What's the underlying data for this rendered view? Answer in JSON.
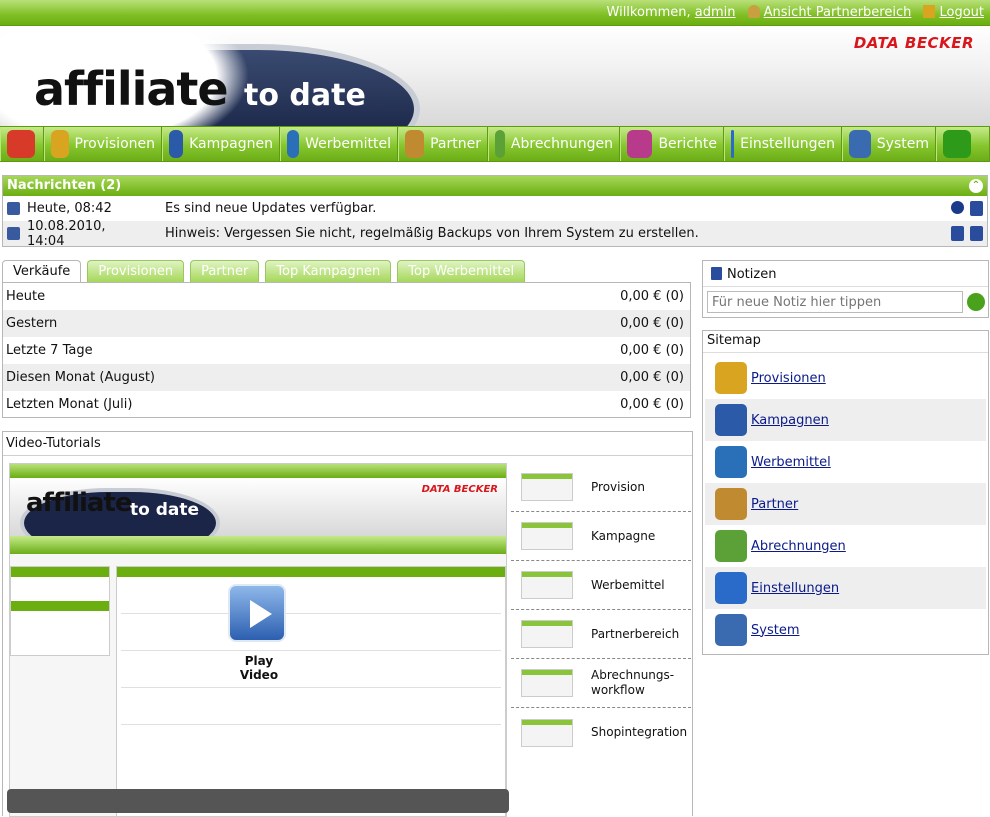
{
  "topbar": {
    "welcome": "Willkommen,",
    "user": "admin",
    "partner_view": "Ansicht Partnerbereich",
    "logout": "Logout"
  },
  "header": {
    "brand_main": "affiliate",
    "brand_sub": "to date",
    "vendor": "DATA BECKER"
  },
  "nav": [
    {
      "label": "",
      "icon": "home-icon",
      "color": "#d83a2a"
    },
    {
      "label": "Provisionen",
      "icon": "scales-icon",
      "color": "#d9a521"
    },
    {
      "label": "Kampagnen",
      "icon": "document-icon",
      "color": "#2a5aa8"
    },
    {
      "label": "Werbemittel",
      "icon": "image-icon",
      "color": "#2a70b8"
    },
    {
      "label": "Partner",
      "icon": "people-icon",
      "color": "#c08a30"
    },
    {
      "label": "Abrechnungen",
      "icon": "money-icon",
      "color": "#5ca038"
    },
    {
      "label": "Berichte",
      "icon": "chart-icon",
      "color": "#b83a8a"
    },
    {
      "label": "Einstellungen",
      "icon": "gear-icon",
      "color": "#2a6ac8"
    },
    {
      "label": "System",
      "icon": "monitor-icon",
      "color": "#3a6ab0"
    },
    {
      "label": "",
      "icon": "help-icon",
      "color": "#2e9a1a"
    }
  ],
  "messages": {
    "title": "Nachrichten (2)",
    "items": [
      {
        "date": "Heute, 08:42",
        "text": "Es sind neue Updates verfügbar."
      },
      {
        "date": "10.08.2010, 14:04",
        "text": "Hinweis: Vergessen Sie nicht, regelmäßig Backups von Ihrem System zu erstellen."
      }
    ]
  },
  "tabs": [
    "Verkäufe",
    "Provisionen",
    "Partner",
    "Top Kampagnen",
    "Top Werbemittel"
  ],
  "sales": [
    {
      "label": "Heute",
      "value": "0,00 € (0)"
    },
    {
      "label": "Gestern",
      "value": "0,00 € (0)"
    },
    {
      "label": "Letzte 7 Tage",
      "value": "0,00 € (0)"
    },
    {
      "label": "Diesen Monat (August)",
      "value": "0,00 € (0)"
    },
    {
      "label": "Letzten Monat (Juli)",
      "value": "0,00 € (0)"
    }
  ],
  "video": {
    "title": "Video-Tutorials",
    "play_label": "Play Video",
    "preview_brand_main": "affiliate",
    "preview_brand_sub": "to date",
    "preview_vendor": "DATA BECKER",
    "items": [
      "Provision",
      "Kampagne",
      "Werbemittel",
      "Partnerbereich",
      "Abrechnungs-workflow",
      "Shopintegration"
    ]
  },
  "notes": {
    "title": "Notizen",
    "placeholder": "Für neue Notiz hier tippen"
  },
  "sitemap": {
    "title": "Sitemap",
    "items": [
      {
        "label": "Provisionen",
        "color": "#d9a521"
      },
      {
        "label": "Kampagnen",
        "color": "#2a5aa8"
      },
      {
        "label": "Werbemittel",
        "color": "#2a70b8"
      },
      {
        "label": "Partner",
        "color": "#c08a30"
      },
      {
        "label": "Abrechnungen",
        "color": "#5ca038"
      },
      {
        "label": "Einstellungen",
        "color": "#2a6ac8"
      },
      {
        "label": "System",
        "color": "#3a6ab0"
      }
    ]
  }
}
